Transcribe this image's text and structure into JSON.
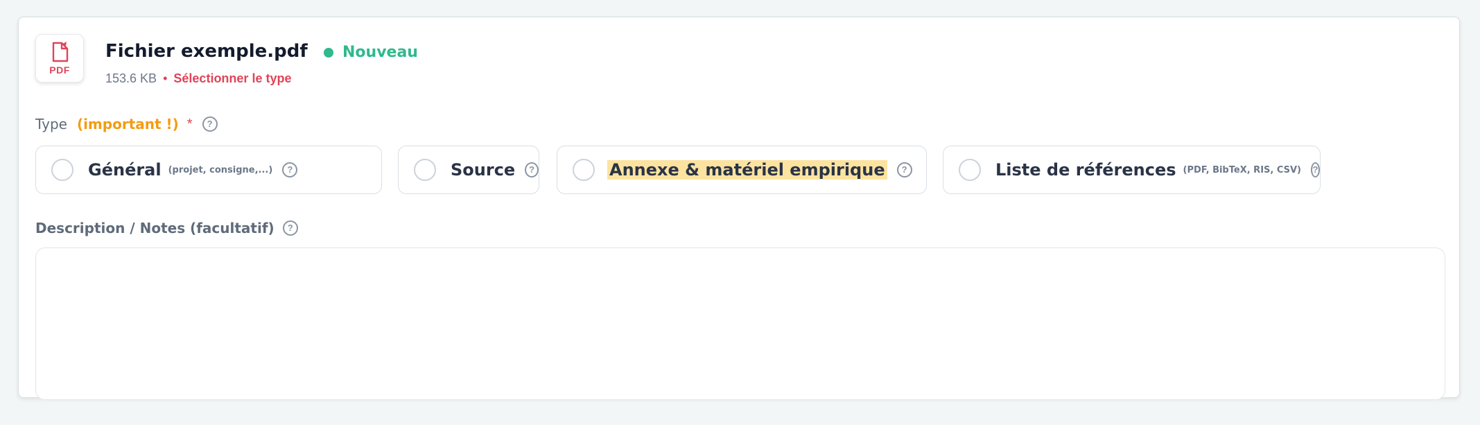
{
  "file": {
    "icon": "pdf-file-icon",
    "icon_label": "PDF",
    "name": "Fichier exemple.pdf",
    "status": "Nouveau",
    "size": "153.6 KB",
    "separator": "•",
    "select_type": "Sélectionner le type"
  },
  "type_section": {
    "label": "Type",
    "important": "(important !)",
    "required_mark": "*",
    "help": "?"
  },
  "options": [
    {
      "label": "Général",
      "hint": "(projet, consigne,...)",
      "help": "?",
      "selected": false
    },
    {
      "label": "Source",
      "hint": "",
      "help": "?",
      "selected": false
    },
    {
      "label": "Annexe & matériel empirique",
      "hint": "",
      "help": "?",
      "selected": false,
      "highlighted": true
    },
    {
      "label": "Liste de références",
      "hint": "(PDF, BibTeX, RIS, CSV)",
      "help": "?",
      "selected": false
    }
  ],
  "description": {
    "label": "Description / Notes (facultatif)",
    "help": "?",
    "value": "",
    "placeholder": ""
  },
  "colors": {
    "accent_red": "#e04358",
    "status_green": "#2fb98d",
    "important_orange": "#f39c12",
    "highlight_yellow": "#fde3a0"
  }
}
